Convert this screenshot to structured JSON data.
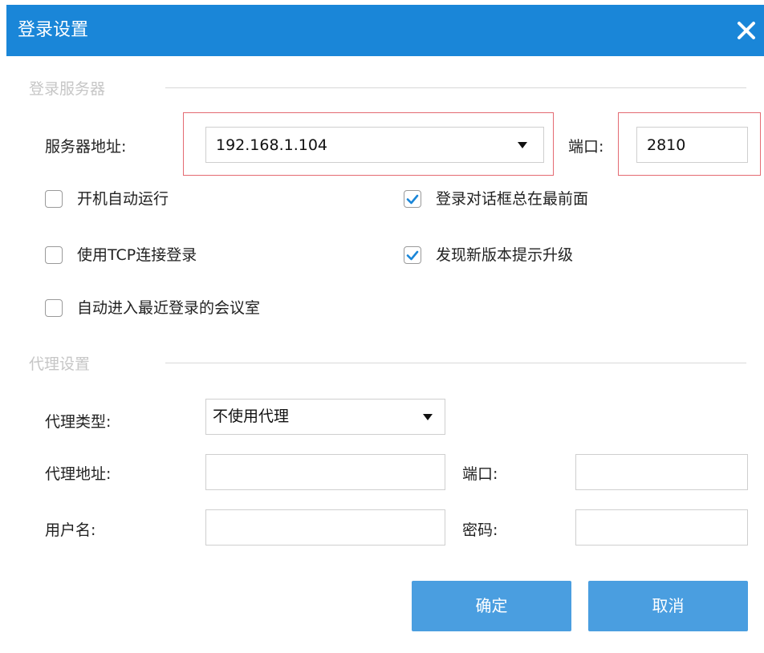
{
  "window": {
    "title": "登录设置",
    "close_icon": "close-icon"
  },
  "server_section": {
    "heading": "登录服务器",
    "address_label": "服务器地址:",
    "address_value": "192.168.1.104",
    "port_label": "端口:",
    "port_value": "2810"
  },
  "options": [
    {
      "label": "开机自动运行",
      "checked": false
    },
    {
      "label": "登录对话框总在最前面",
      "checked": true
    },
    {
      "label": "使用TCP连接登录",
      "checked": false
    },
    {
      "label": "发现新版本提示升级",
      "checked": true
    },
    {
      "label": "自动进入最近登录的会议室",
      "checked": false
    }
  ],
  "proxy_section": {
    "heading": "代理设置",
    "type_label": "代理类型:",
    "type_value": "不使用代理",
    "address_label": "代理地址:",
    "address_value": "",
    "port_label": "端口:",
    "port_value": "",
    "username_label": "用户名:",
    "username_value": "",
    "password_label": "密码:",
    "password_value": ""
  },
  "buttons": {
    "ok": "确定",
    "cancel": "取消"
  },
  "colors": {
    "titlebar": "#1a86d8",
    "button": "#4a9ee0",
    "highlight_frame": "#e46a72",
    "check": "#1a86d8"
  }
}
